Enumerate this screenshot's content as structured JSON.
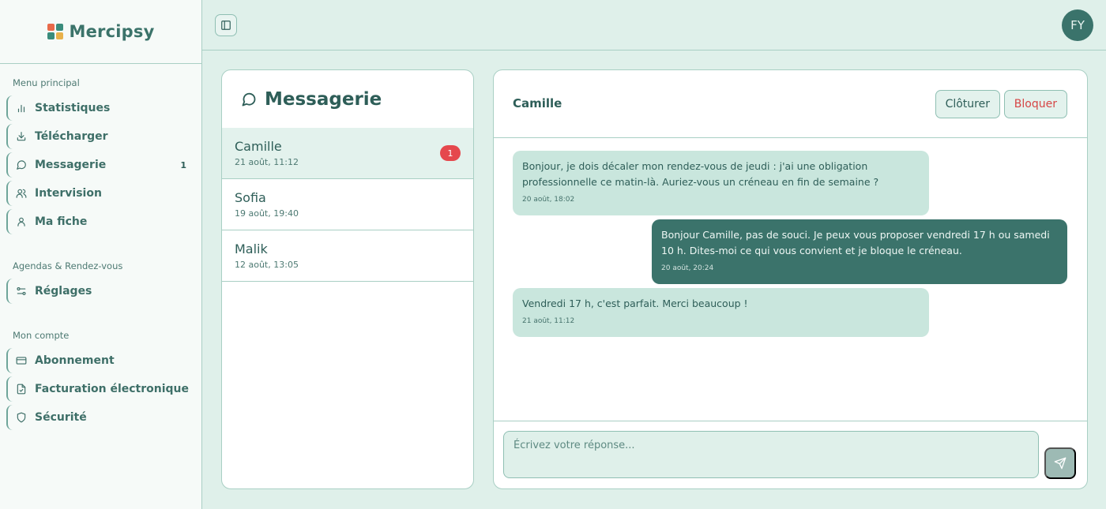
{
  "app": {
    "name": "Mercipsy"
  },
  "sidebar": {
    "sections": [
      {
        "title": "Menu principal",
        "items": [
          {
            "label": "Statistiques",
            "icon": "bar-chart-icon"
          },
          {
            "label": "Télécharger",
            "icon": "download-icon"
          },
          {
            "label": "Messagerie",
            "icon": "message-circle-icon",
            "badge": "1"
          },
          {
            "label": "Intervision",
            "icon": "users-icon"
          },
          {
            "label": "Ma fiche",
            "icon": "user-icon"
          }
        ]
      },
      {
        "title": "Agendas & Rendez-vous",
        "items": [
          {
            "label": "Réglages",
            "icon": "sliders-icon"
          }
        ]
      },
      {
        "title": "Mon compte",
        "items": [
          {
            "label": "Abonnement",
            "icon": "credit-card-icon"
          },
          {
            "label": "Facturation électronique",
            "icon": "file-check-icon"
          },
          {
            "label": "Sécurité",
            "icon": "shield-icon"
          }
        ]
      }
    ]
  },
  "topbar": {
    "avatar_initials": "FY"
  },
  "conversations": {
    "title": "Messagerie",
    "items": [
      {
        "name": "Camille",
        "date": "21 août, 11:12",
        "unread": "1"
      },
      {
        "name": "Sofia",
        "date": "19 août, 19:40"
      },
      {
        "name": "Malik",
        "date": "12 août, 13:05"
      }
    ]
  },
  "chat": {
    "contact": "Camille",
    "close_label": "Clôturer",
    "block_label": "Bloquer",
    "messages": [
      {
        "direction": "in",
        "text": "Bonjour, je dois décaler mon rendez-vous de jeudi : j'ai une obligation professionnelle ce matin-là. Auriez-vous un créneau en fin de semaine ?",
        "time": "20 août, 18:02"
      },
      {
        "direction": "out",
        "text": "Bonjour Camille, pas de souci. Je peux vous proposer vendredi 17 h ou samedi 10 h. Dites-moi ce qui vous convient et je bloque le créneau.",
        "time": "20 août, 20:24"
      },
      {
        "direction": "in",
        "text": "Vendredi 17 h, c'est parfait. Merci beaucoup !",
        "time": "21 août, 11:12"
      }
    ],
    "reply_placeholder": "Écrivez votre réponse..."
  },
  "colors": {
    "background": "#dff0ea",
    "accent": "#3b736b",
    "incoming_bubble": "#c9e6dd",
    "danger": "#e5484d"
  }
}
